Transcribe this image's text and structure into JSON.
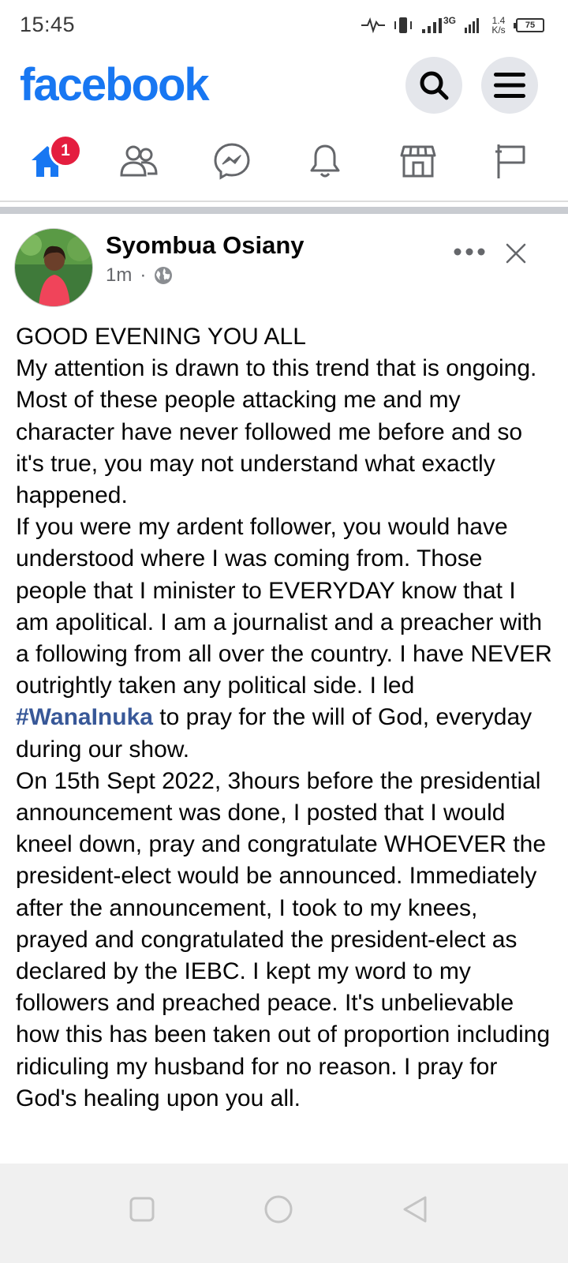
{
  "status_bar": {
    "time": "15:45",
    "network_type": "3G",
    "speed_value": "1.4",
    "speed_unit": "K/s",
    "battery": "75"
  },
  "header": {
    "logo": "facebook",
    "search_icon": "search-icon",
    "menu_icon": "hamburger-menu-icon"
  },
  "nav_tabs": [
    {
      "name": "home",
      "icon": "home-icon",
      "active": true,
      "badge": "1"
    },
    {
      "name": "friends",
      "icon": "friends-icon"
    },
    {
      "name": "messenger",
      "icon": "messenger-icon"
    },
    {
      "name": "notifications",
      "icon": "bell-icon"
    },
    {
      "name": "marketplace",
      "icon": "marketplace-icon"
    },
    {
      "name": "pages",
      "icon": "flag-icon"
    }
  ],
  "post": {
    "author": "Syombua Osiany",
    "time": "1m",
    "separator": "·",
    "privacy_icon": "globe-icon",
    "greeting": "GOOD EVENING YOU ALL",
    "text_before_hashtag": "My attention is drawn to this trend that is ongoing. Most of these people attacking me and my character have never followed me before and so it's true, you may not understand what exactly happened.\nIf you were my ardent follower, you would have understood where I was coming from. Those people that I minister to EVERYDAY know that I am apolitical. I am a journalist and a preacher with a following from all over the country. I have NEVER outrightly taken any political side. I led ",
    "hashtag": "#WanaInuka",
    "text_after_hashtag": " to pray for the will of God, everyday during our show.\nOn 15th Sept 2022, 3hours before the presidential announcement was done, I posted that I would kneel down, pray and congratulate WHOEVER the president-elect would be announced. Immediately after the announcement, I took to my knees, prayed and congratulated the president-elect as declared by the IEBC. I kept my word to my followers and preached peace. It's unbelievable how this has been taken out of proportion including ridiculing my husband for no reason. I pray for God's healing upon you all."
  },
  "colors": {
    "brand": "#1877f2",
    "badge": "#e41e3f",
    "hashtag": "#385898",
    "meta": "#65676b"
  },
  "android_nav": [
    "square-recents-icon",
    "circle-home-icon",
    "triangle-back-icon"
  ]
}
